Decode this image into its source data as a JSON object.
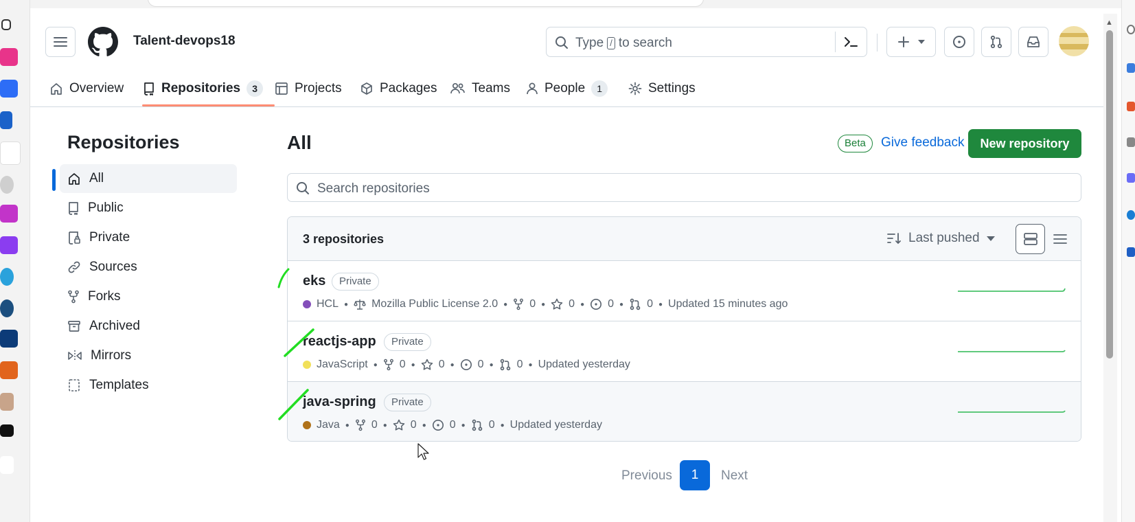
{
  "header": {
    "org_name": "Talent-devops18",
    "search_placeholder_pre": "Type",
    "search_key": "/",
    "search_placeholder_post": "to search"
  },
  "tabs": [
    {
      "label": "Overview",
      "icon": "home-icon"
    },
    {
      "label": "Repositories",
      "count": "3",
      "icon": "repo-icon",
      "active": true
    },
    {
      "label": "Projects",
      "icon": "table-icon"
    },
    {
      "label": "Packages",
      "icon": "package-icon"
    },
    {
      "label": "Teams",
      "icon": "people-icon"
    },
    {
      "label": "People",
      "count": "1",
      "icon": "person-icon"
    },
    {
      "label": "Settings",
      "icon": "gear-icon"
    }
  ],
  "sidebar": {
    "title": "Repositories",
    "items": [
      {
        "label": "All",
        "icon": "home-icon",
        "active": true
      },
      {
        "label": "Public",
        "icon": "repo-icon"
      },
      {
        "label": "Private",
        "icon": "lock-repo-icon"
      },
      {
        "label": "Sources",
        "icon": "link-icon"
      },
      {
        "label": "Forks",
        "icon": "fork-icon"
      },
      {
        "label": "Archived",
        "icon": "archive-icon"
      },
      {
        "label": "Mirrors",
        "icon": "mirror-icon"
      },
      {
        "label": "Templates",
        "icon": "template-icon"
      }
    ]
  },
  "main": {
    "title": "All",
    "beta_label": "Beta",
    "feedback_label": "Give feedback",
    "new_repo_label": "New repository",
    "search_placeholder": "Search repositories",
    "count_label": "3 repositories",
    "sort_label": "Last pushed"
  },
  "repos": [
    {
      "name": "eks",
      "visibility": "Private",
      "language": "HCL",
      "lang_color": "#844fba",
      "license": "Mozilla Public License 2.0",
      "forks": "0",
      "stars": "0",
      "issues": "0",
      "prs": "0",
      "updated": "Updated 15 minutes ago"
    },
    {
      "name": "reactjs-app",
      "visibility": "Private",
      "language": "JavaScript",
      "lang_color": "#f1e05a",
      "forks": "0",
      "stars": "0",
      "issues": "0",
      "prs": "0",
      "updated": "Updated yesterday"
    },
    {
      "name": "java-spring",
      "visibility": "Private",
      "language": "Java",
      "lang_color": "#b07219",
      "forks": "0",
      "stars": "0",
      "issues": "0",
      "prs": "0",
      "updated": "Updated yesterday"
    }
  ],
  "pager": {
    "prev": "Previous",
    "current": "1",
    "next": "Next"
  },
  "colors": {
    "accent": "#0969da",
    "primary_button": "#1f883d",
    "tab_underline": "#fd8c73",
    "annotation": "#22dd22"
  }
}
